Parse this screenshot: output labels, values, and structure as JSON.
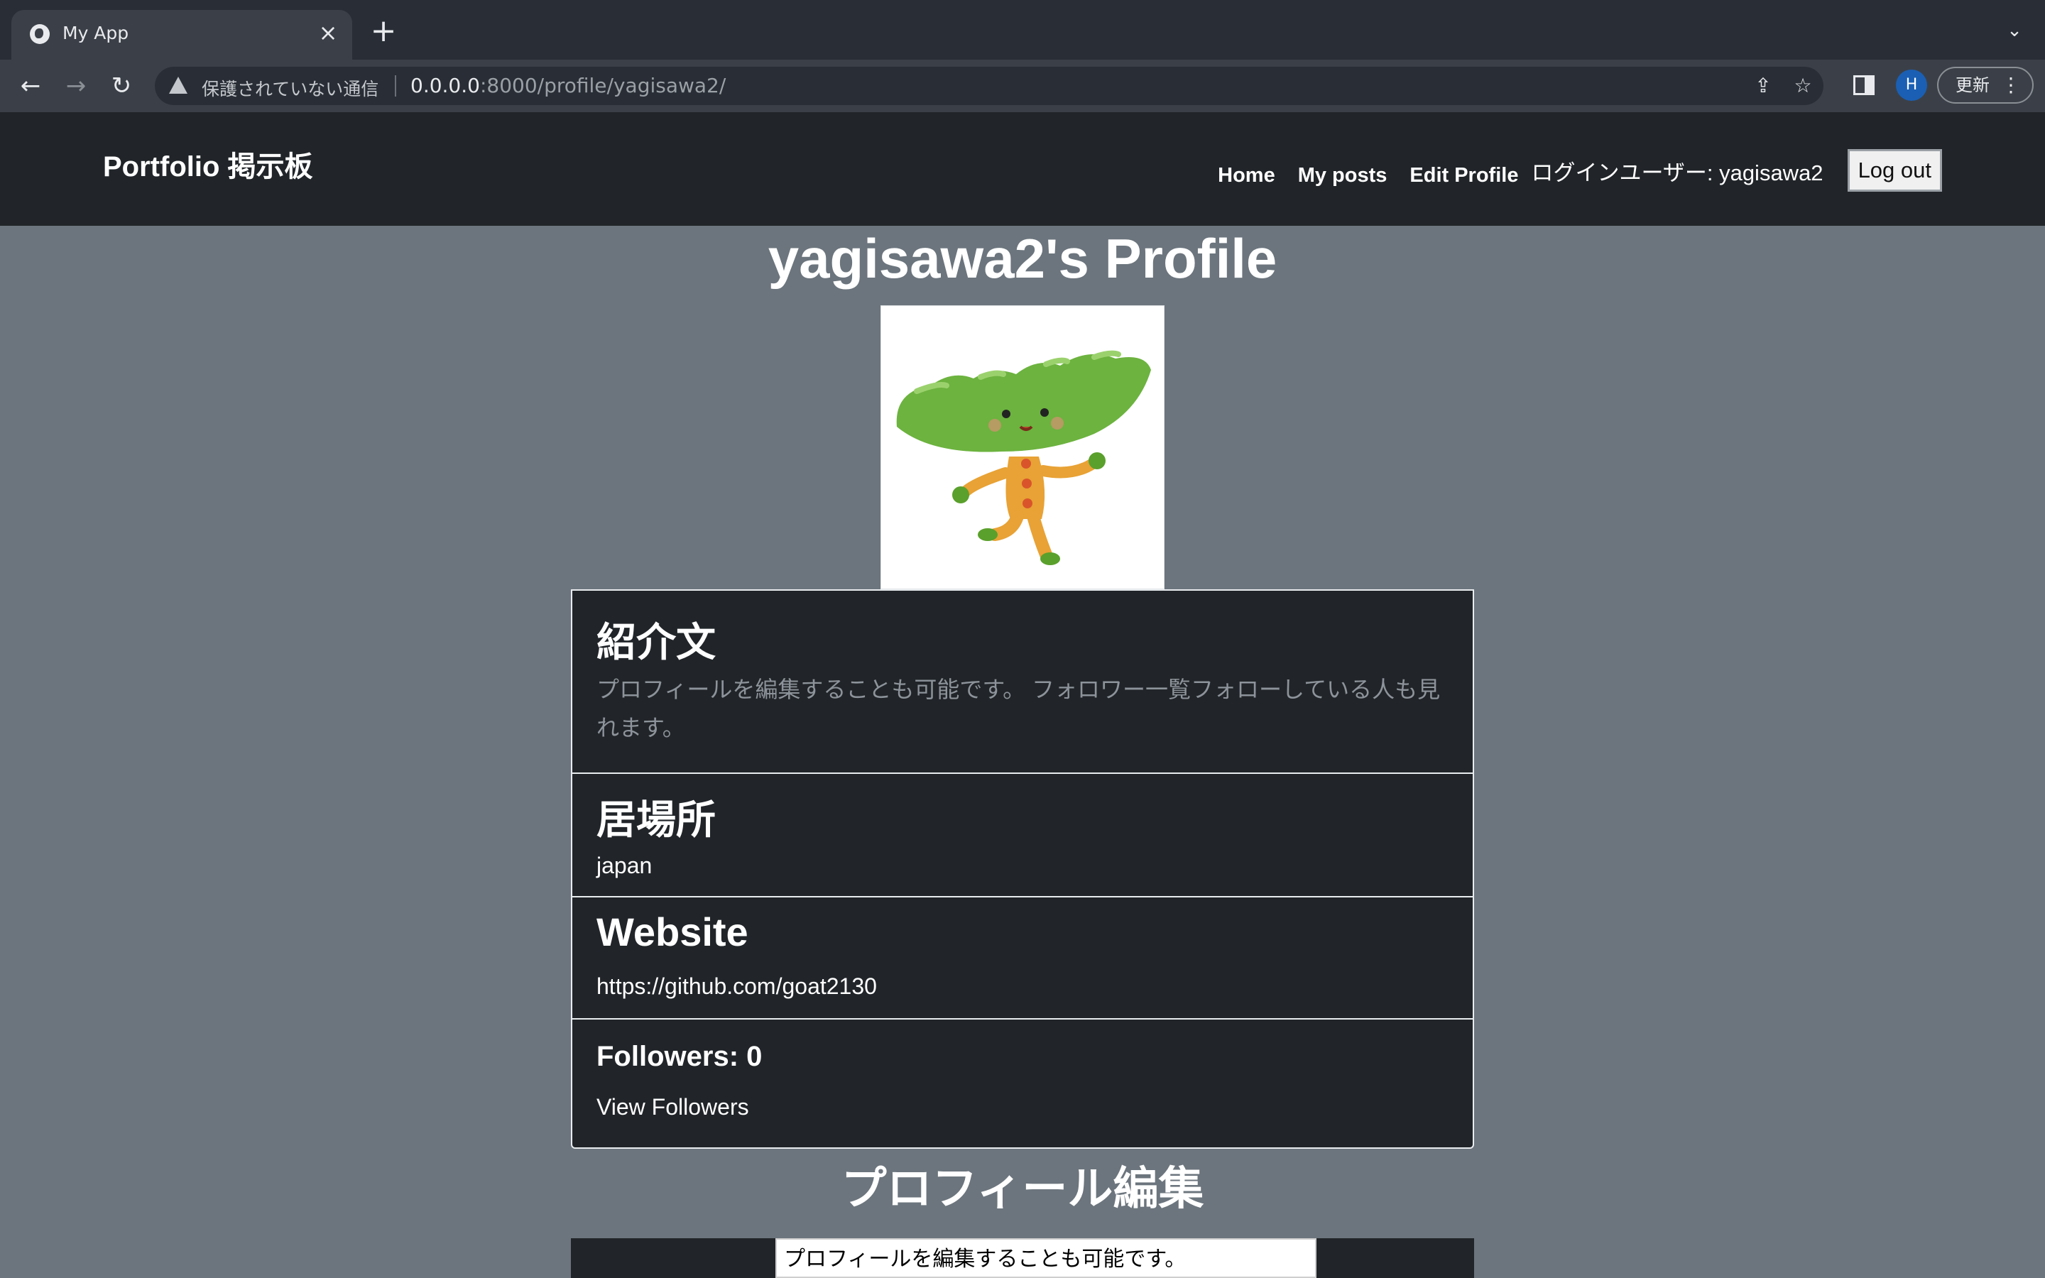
{
  "browser": {
    "tab_title": "My App",
    "tab_close": "×",
    "new_tab": "+",
    "tab_menu": "⌄",
    "security_text": "保護されていない通信",
    "url_host": "0.0.0.0",
    "url_path": ":8000/profile/yagisawa2/",
    "avatar_initial": "H",
    "update_label": "更新",
    "back_icon": "←",
    "forward_icon": "→",
    "reload_icon": "↻",
    "share_icon": "⇪",
    "star_icon": "☆",
    "menu_icon": "⋮"
  },
  "navbar": {
    "brand": "Portfolio 掲示板",
    "links": [
      "Home",
      "My posts",
      "Edit Profile"
    ],
    "login_user": "ログインユーザー: yagisawa2",
    "logout": "Log out"
  },
  "profile": {
    "title": "yagisawa2's Profile",
    "bio_heading": "紹介文",
    "bio_text": "プロフィールを編集することも可能です。 フォロワー一覧フォローしている人も見れます。",
    "location_heading": "居場所",
    "location": "japan",
    "website_heading": "Website",
    "website": "https://github.com/goat2130",
    "followers_label": "Followers: 0",
    "view_followers": "View Followers"
  },
  "edit": {
    "title": "プロフィール編集",
    "bio_value": "プロフィールを編集することも可能です。"
  },
  "colors": {
    "page_bg": "#6c757d",
    "dark": "#212529",
    "muted_text": "#8d939a"
  }
}
